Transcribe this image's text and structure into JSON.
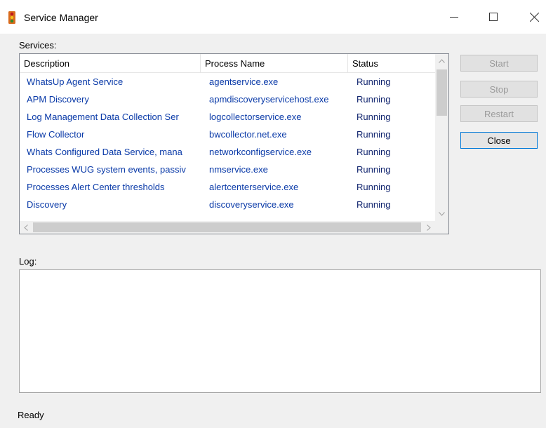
{
  "window": {
    "title": "Service Manager",
    "minimize_icon": "minimize-icon",
    "maximize_icon": "maximize-icon",
    "close_icon": "close-icon"
  },
  "services": {
    "label": "Services:",
    "columns": [
      "Description",
      "Process Name",
      "Status"
    ],
    "rows": [
      {
        "description": "WhatsUp Agent Service",
        "process": "agentservice.exe",
        "status": "Running"
      },
      {
        "description": "APM Discovery",
        "process": "apmdiscoveryservicehost.exe",
        "status": "Running"
      },
      {
        "description": "Log Management Data Collection Ser",
        "process": "logcollectorservice.exe",
        "status": "Running"
      },
      {
        "description": "Flow Collector",
        "process": "bwcollector.net.exe",
        "status": "Running"
      },
      {
        "description": "Whats Configured Data Service, mana",
        "process": "networkconfigservice.exe",
        "status": "Running"
      },
      {
        "description": "Processes WUG system events, passiv",
        "process": "nmservice.exe",
        "status": "Running"
      },
      {
        "description": "Processes Alert Center thresholds",
        "process": "alertcenterservice.exe",
        "status": "Running"
      },
      {
        "description": "Discovery",
        "process": "discoveryservice.exe",
        "status": "Running"
      }
    ]
  },
  "buttons": {
    "start": "Start",
    "stop": "Stop",
    "restart": "Restart",
    "close": "Close"
  },
  "log": {
    "label": "Log:",
    "content": ""
  },
  "statusbar": {
    "text": "Ready"
  },
  "colors": {
    "link_text": "#0a3aa8",
    "window_bg": "#f0f0f0",
    "focus_border": "#0078d7"
  }
}
